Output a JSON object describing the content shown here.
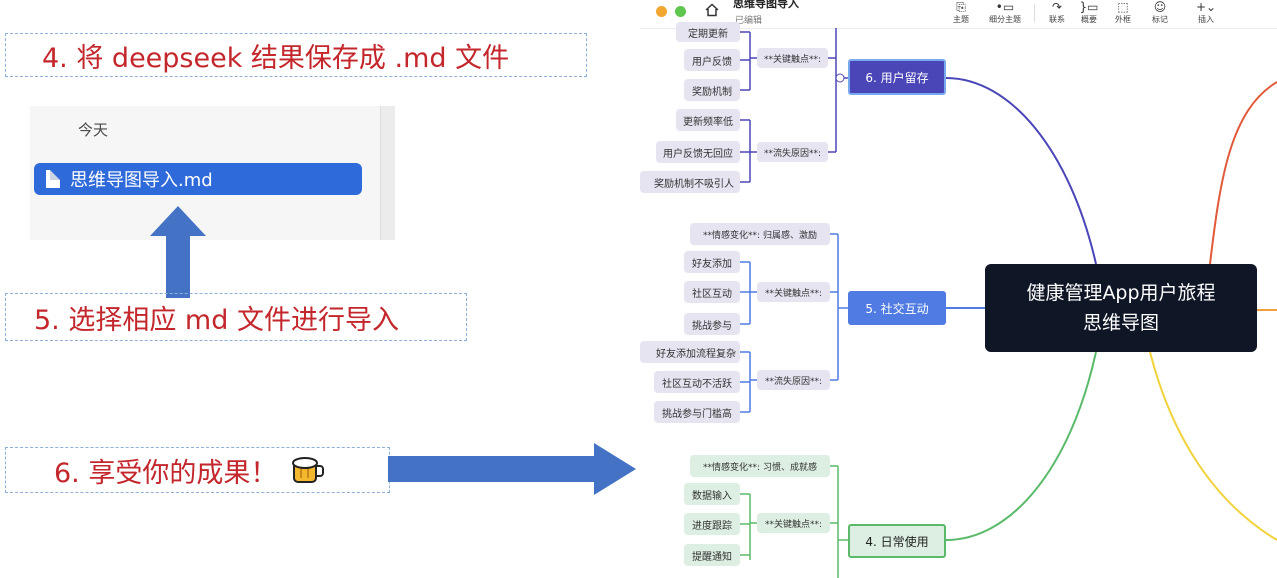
{
  "steps": {
    "step4": "4. 将 deepseek 结果保存成 .md 文件",
    "step5": "5. 选择相应 md 文件进行导入",
    "step6": "6. 享受你的成果！"
  },
  "finder": {
    "section_label": "今天",
    "file_name": "思维导图导入.md"
  },
  "app_window": {
    "title": "思维导图导入",
    "subtitle": "已编辑",
    "toolbar": [
      {
        "label": "主题",
        "icon": "theme-icon"
      },
      {
        "label": "细分主题",
        "icon": "subtopic-icon"
      },
      {
        "label": "联系",
        "icon": "relationship-icon"
      },
      {
        "label": "概要",
        "icon": "summary-icon"
      },
      {
        "label": "外框",
        "icon": "boundary-icon"
      },
      {
        "label": "标记",
        "icon": "marker-icon"
      },
      {
        "label": "插入",
        "icon": "insert-icon"
      }
    ]
  },
  "mindmap": {
    "central": {
      "line1": "健康管理App用户旅程",
      "line2": "思维导图"
    },
    "branches": [
      {
        "title": "6. 用户留存",
        "color": "#4b46b8",
        "key_touch": "**关键触点**:",
        "touch_items": [
          "定期更新",
          "用户反馈",
          "奖励机制"
        ],
        "churn": "**流失原因**:",
        "churn_items": [
          "更新频率低",
          "用户反馈无回应",
          "奖励机制不吸引人"
        ]
      },
      {
        "title": "5. 社交互动",
        "color": "#4f7be2",
        "emotion": "**情感变化**: 归属感、激励",
        "key_touch": "**关键触点**:",
        "touch_items": [
          "好友添加",
          "社区互动",
          "挑战参与"
        ],
        "churn": "**流失原因**:",
        "churn_items": [
          "好友添加流程复杂",
          "社区互动不活跃",
          "挑战参与门槛高"
        ]
      },
      {
        "title": "4. 日常使用",
        "color": "#5aba6a",
        "emotion": "**情感变化**: 习惯、成就感",
        "key_touch": "**关键触点**:",
        "touch_items": [
          "数据输入",
          "进度跟踪",
          "提醒通知"
        ]
      }
    ]
  },
  "colors": {
    "step_text": "#c3262b",
    "arrow": "#4472c4",
    "finder_selected": "#2e6ad9",
    "central_bg": "#0f1626"
  }
}
